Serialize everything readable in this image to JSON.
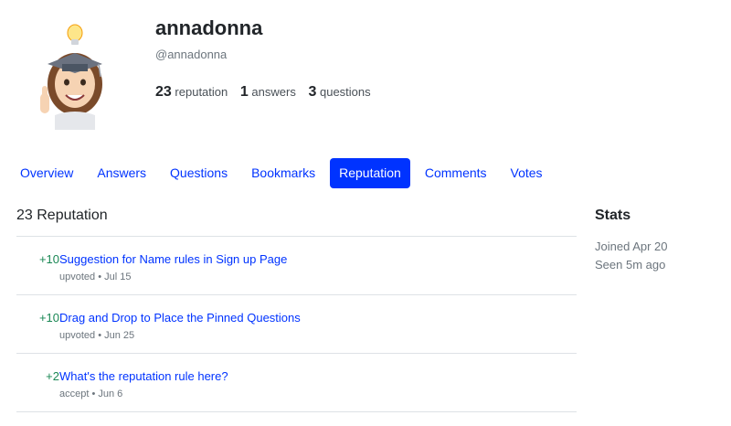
{
  "profile": {
    "name": "annadonna",
    "handle": "@annadonna",
    "stats": [
      {
        "value": "23",
        "label": "reputation"
      },
      {
        "value": "1",
        "label": "answers"
      },
      {
        "value": "3",
        "label": "questions"
      }
    ]
  },
  "tabs": [
    "Overview",
    "Answers",
    "Questions",
    "Bookmarks",
    "Reputation",
    "Comments",
    "Votes"
  ],
  "active_tab": "Reputation",
  "reputation": {
    "title": "23 Reputation",
    "items": [
      {
        "points": "+10",
        "title": "Suggestion for Name rules in Sign up Page",
        "meta": "upvoted • Jul 15"
      },
      {
        "points": "+10",
        "title": "Drag and Drop to Place the Pinned Questions",
        "meta": "upvoted • Jun 25"
      },
      {
        "points": "+2",
        "title": "What's the reputation rule here?",
        "meta": "accept • Jun 6"
      }
    ]
  },
  "stats_panel": {
    "title": "Stats",
    "joined": "Joined Apr 20",
    "seen": "Seen 5m ago"
  },
  "colors": {
    "accent": "#0033ff",
    "positive": "#198754",
    "muted": "#6c757d"
  },
  "icons": {
    "avatar": "memoji-graduate-avatar"
  }
}
